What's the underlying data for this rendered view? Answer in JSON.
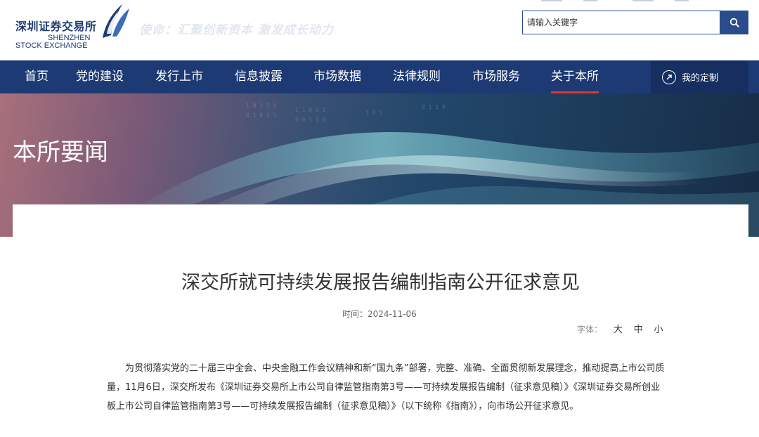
{
  "header": {
    "logo_cn": "深圳证券交易所",
    "logo_en_line1": "SHENZHEN",
    "logo_en_line2": "STOCK EXCHANGE",
    "slogan": "使命：汇聚创新资本 激发成长动力"
  },
  "search": {
    "placeholder": "请输入关键字",
    "button_icon": "search-icon"
  },
  "nav": {
    "items": [
      {
        "label": "首页"
      },
      {
        "label": "党的建设"
      },
      {
        "label": "发行上市"
      },
      {
        "label": "信息披露"
      },
      {
        "label": "市场数据"
      },
      {
        "label": "法律规则"
      },
      {
        "label": "市场服务"
      },
      {
        "label": "关于本所",
        "active": true
      }
    ],
    "custom_label": "我的定制",
    "active_color": "#e3342f",
    "bg_color": "#1d3a74"
  },
  "banner": {
    "title": "本所要闻"
  },
  "article": {
    "title": "深交所就可持续发展报告编制指南公开征求意见",
    "date_label": "时间：",
    "date": "2024-11-06",
    "fontsize_label": "字体：",
    "fontsize_options": [
      "大",
      "中",
      "小"
    ],
    "paragraph": "为贯彻落实党的二十届三中全会、中央金融工作会议精神和新“国九条”部署，完整、准确、全面贯彻新发展理念，推动提高上市公司质量，11月6日，深交所发布《深圳证券交易所上市公司自律监管指南第3号——可持续发展报告编制（征求意见稿）》《深圳证券交易所创业板上市公司自律监管指南第3号——可持续发展报告编制（征求意见稿）》（以下统称《指南》），向市场公开征求意见。"
  }
}
